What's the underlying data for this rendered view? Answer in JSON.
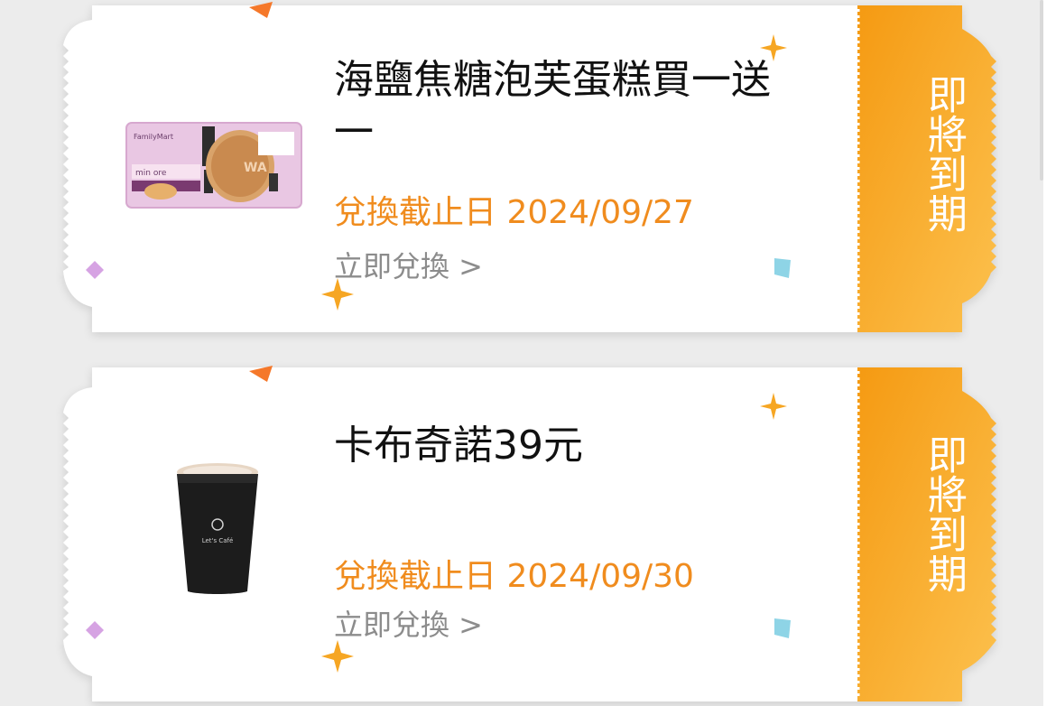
{
  "colors": {
    "accent_orange": "#f08c1e",
    "stub_orange": "#f7a21c",
    "stub_light": "#fcc85a",
    "muted_gray": "#8c8c8c",
    "title_black": "#111111"
  },
  "coupons": [
    {
      "title": "海鹽焦糖泡芙蛋糕買一送一",
      "expiry_label": "兌換截止日",
      "expiry_date": "2024/09/27",
      "redeem_label": "立即兌換 >",
      "stub_label": "即將到期",
      "image_icon": "cream-puff-cake-package-image"
    },
    {
      "title": "卡布奇諾39元",
      "expiry_label": "兌換截止日",
      "expiry_date": "2024/09/30",
      "redeem_label": "立即兌換 >",
      "stub_label": "即將到期",
      "image_icon": "coffee-cup-image"
    }
  ]
}
